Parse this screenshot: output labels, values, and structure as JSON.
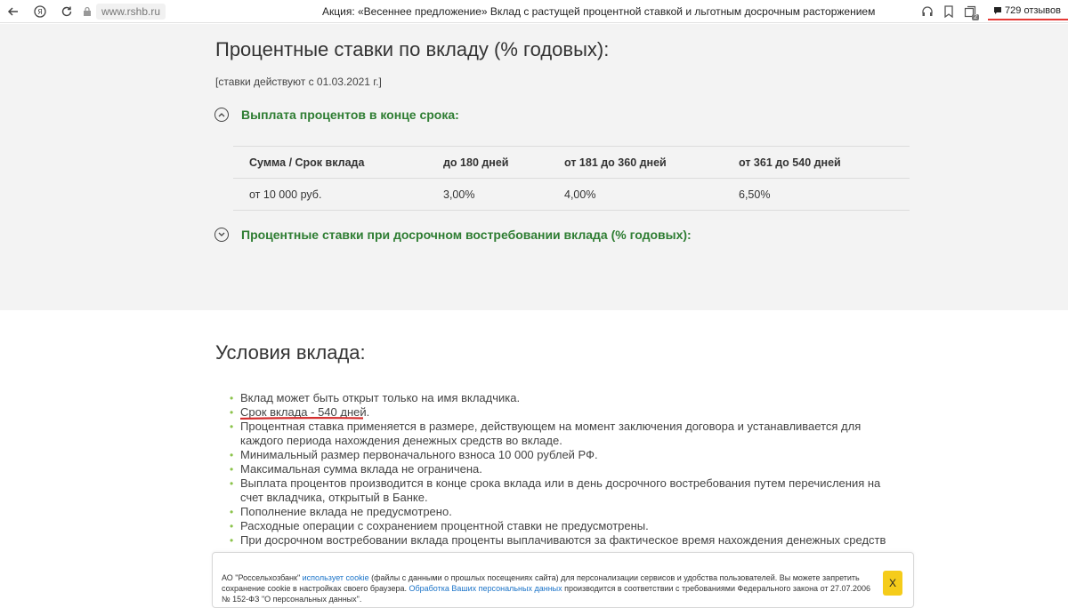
{
  "browser": {
    "url": "www.rshb.ru",
    "title": "Акция: «Весеннее предложение» Вклад с растущей процентной ставкой и льготным досрочным расторжением",
    "reviews": "729 отзывов",
    "tab_count": "2"
  },
  "rates": {
    "title": "Процентные ставки по вкладу (% годовых):",
    "note": "[ставки действуют с 01.03.2021 г.]",
    "section1_label": "Выплата процентов в конце срока:",
    "table": {
      "headers": [
        "Сумма / Срок вклада",
        "до 180 дней",
        "от 181 до 360 дней",
        "от 361 до 540 дней"
      ],
      "row": [
        "от 10 000 руб.",
        "3,00%",
        "4,00%",
        "6,50%"
      ]
    },
    "section2_label": "Процентные ставки при досрочном востребовании вклада (% годовых):"
  },
  "conditions": {
    "title": "Условия вклада:",
    "items": [
      "Вклад может быть открыт только на имя вкладчика.",
      "Срок вклада - 540 дней.",
      "Процентная ставка применяется в размере, действующем на момент заключения договора и устанавливается для каждого периода нахождения денежных средств во вкладе.",
      "Минимальный размер первоначального взноса 10 000 рублей РФ.",
      "Максимальная сумма вклада не ограничена.",
      "Выплата процентов производится в конце срока вклада или в день досрочного востребования путем перечисления на счет вкладчика, открытый в Банке.",
      "Пополнение вклада не предусмотрено.",
      "Расходные операции с сохранением процентной ставки не предусмотрены.",
      "При досрочном востребовании вклада проценты выплачиваются за фактическое время нахождения денежных средств во"
    ]
  },
  "cookie": {
    "text_1": "АО \"Россельхозбанк\" ",
    "link_1": "использует cookie",
    "text_2": " (файлы с данными о прошлых посещениях сайта) для персонализации сервисов и удобства пользователей. Вы можете запретить сохранение cookie в настройках своего браузера. ",
    "link_2": "Обработка Ваших персональных данных",
    "text_3": " производится в соответствии с требованиями Федерального закона от 27.07.2006 № 152-ФЗ \"О персональных данных\".",
    "close_label": "X"
  },
  "colors": {
    "accent_green": "#2e7d32",
    "bullet_green": "#8bc34a",
    "highlight_red": "#d32f2f",
    "cookie_button": "#f5cc1a"
  }
}
